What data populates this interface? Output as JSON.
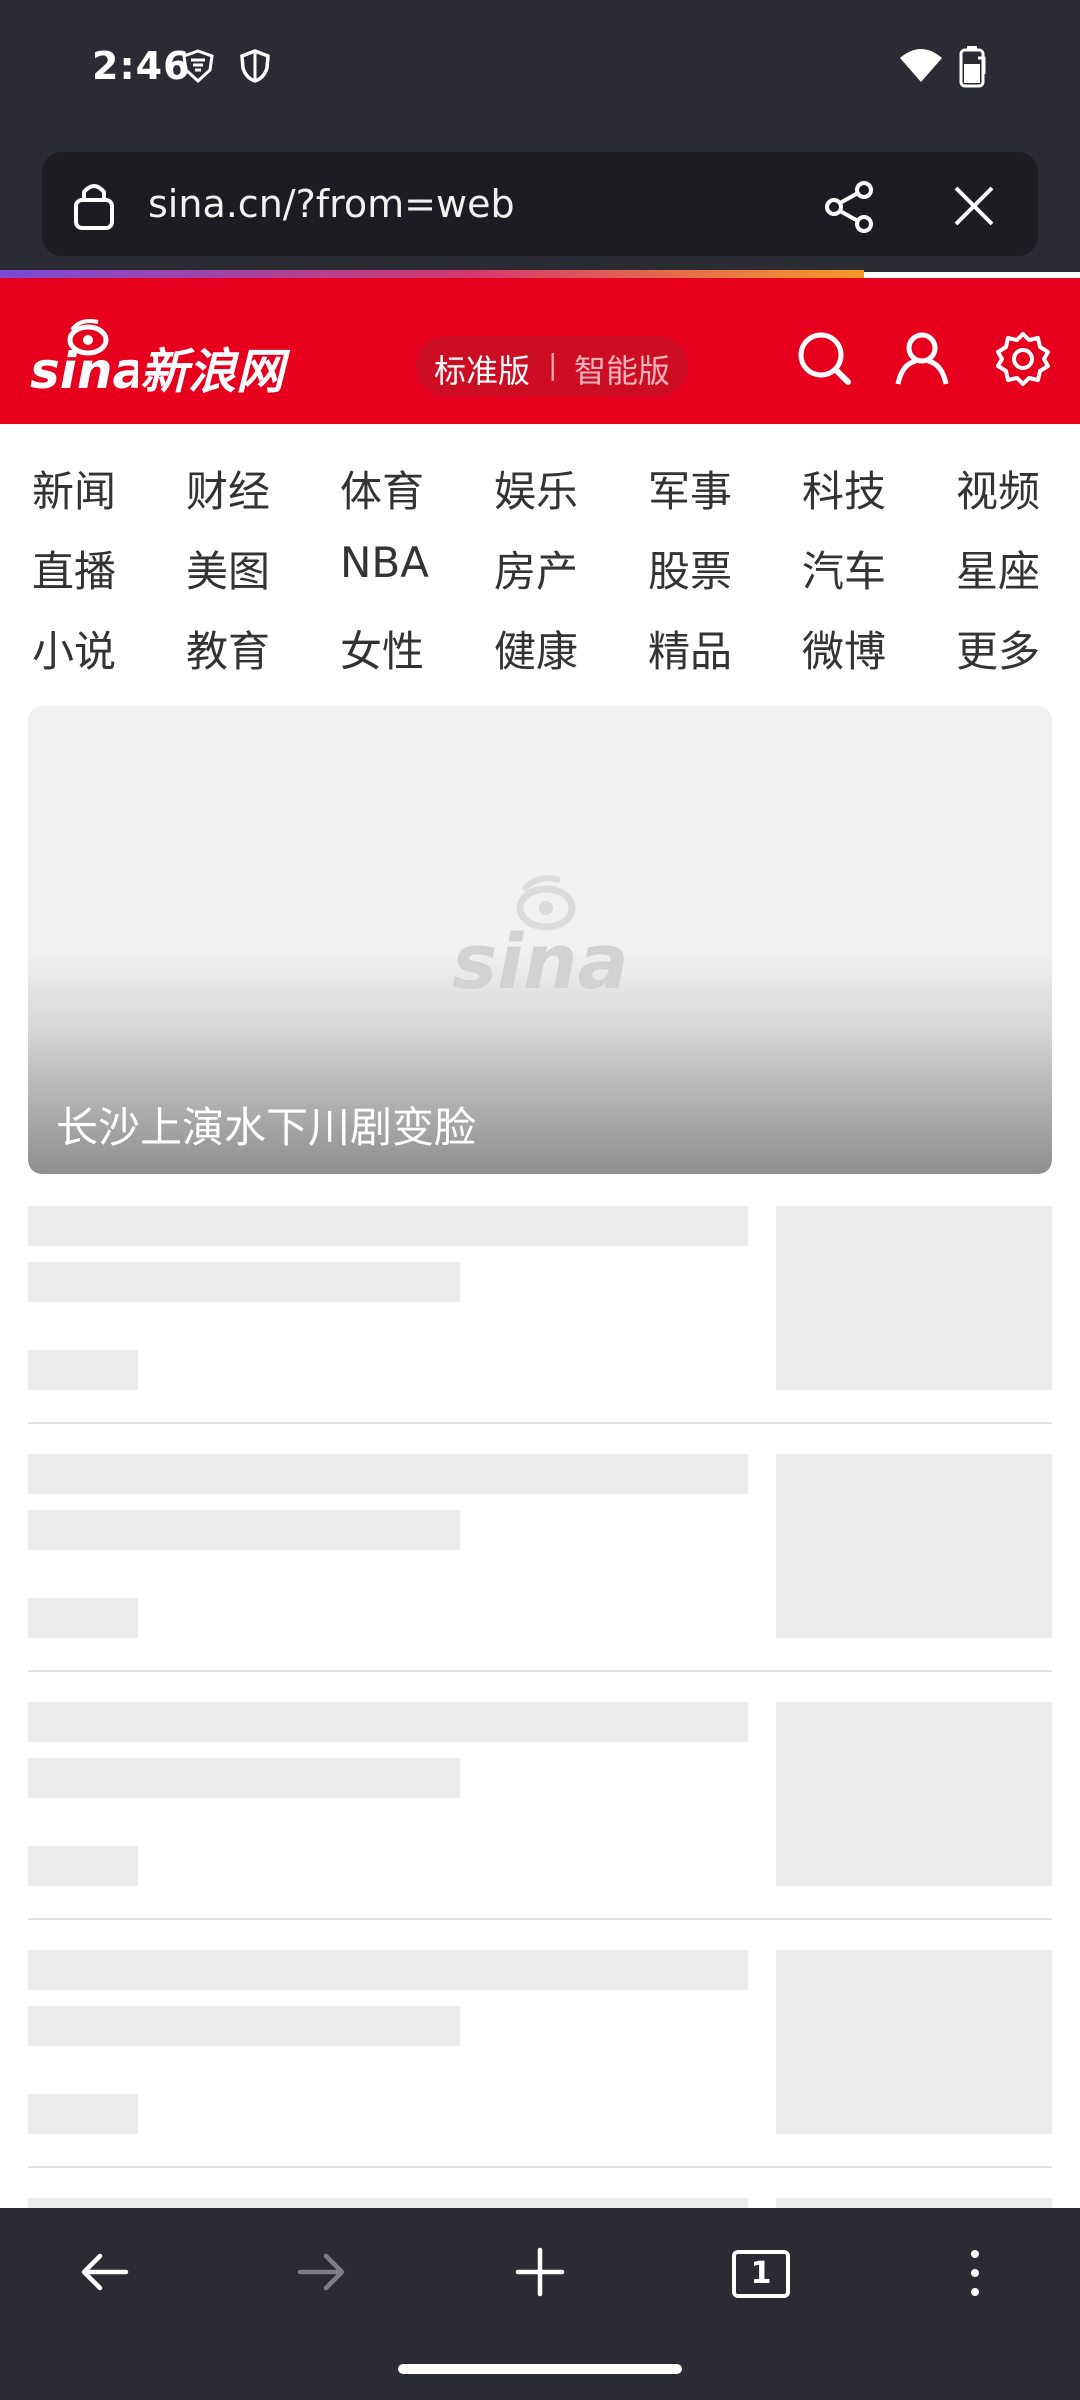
{
  "status_bar": {
    "time": "2:46",
    "icons": [
      "vpn-shield-icon",
      "shield-icon",
      "wifi-icon",
      "battery-icon"
    ]
  },
  "browser": {
    "url": "sina.cn/?from=web",
    "icons": [
      "lock-icon",
      "share-icon",
      "close-icon"
    ],
    "tab_count": "1"
  },
  "header": {
    "logo_text": "sina",
    "logo_word": "新浪网",
    "mode_standard": "标准版",
    "mode_separator": "|",
    "mode_smart": "智能版",
    "icons": [
      "search-icon",
      "user-icon",
      "settings-icon"
    ],
    "brand_color": "#e6001e"
  },
  "nav": {
    "rows": [
      [
        "新闻",
        "财经",
        "体育",
        "娱乐",
        "军事",
        "科技",
        "视频"
      ],
      [
        "直播",
        "美图",
        "NBA",
        "房产",
        "股票",
        "汽车",
        "星座"
      ],
      [
        "小说",
        "教育",
        "女性",
        "健康",
        "精品",
        "微博",
        "更多"
      ]
    ]
  },
  "hero": {
    "watermark": "sina",
    "caption": "长沙上演水下川剧变脸"
  },
  "toolbar": {
    "icons": [
      "back-arrow-icon",
      "forward-arrow-icon",
      "new-tab-plus-icon",
      "tab-switcher-icon",
      "more-menu-icon"
    ]
  }
}
